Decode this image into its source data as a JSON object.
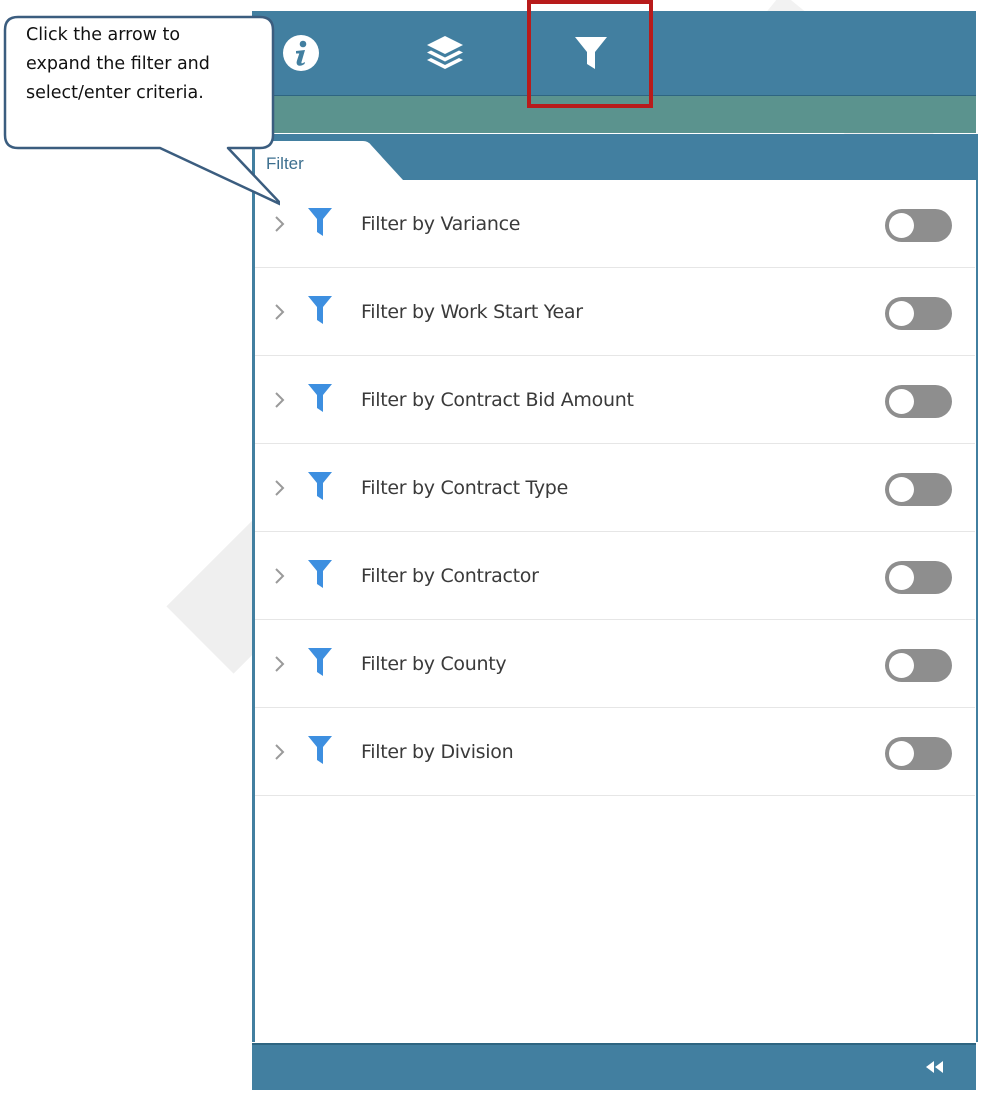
{
  "toolbar": {
    "buttons": [
      {
        "icon": "info-icon"
      },
      {
        "icon": "layers-icon"
      },
      {
        "icon": "filter-icon",
        "active": true
      }
    ],
    "highlight_color": "#b81b1b"
  },
  "panel": {
    "tab_label": "Filter",
    "filters": [
      {
        "label": "Filter by Variance",
        "enabled": false
      },
      {
        "label": "Filter by Work Start Year",
        "enabled": false
      },
      {
        "label": "Filter by Contract Bid Amount",
        "enabled": false
      },
      {
        "label": "Filter by Contract Type",
        "enabled": false
      },
      {
        "label": "Filter by Contractor",
        "enabled": false
      },
      {
        "label": "Filter by County",
        "enabled": false
      },
      {
        "label": "Filter by Division",
        "enabled": false
      }
    ]
  },
  "callout": {
    "lines": [
      "Click the arrow to",
      "expand the filter and",
      "select/enter criteria."
    ]
  },
  "footer": {
    "collapse_icon": "double-chevron-left-icon"
  },
  "colors": {
    "header": "#427fa0",
    "subheader": "#5b938e",
    "funnel": "#3d8fe0",
    "toggle_off": "#8e8e8e"
  }
}
